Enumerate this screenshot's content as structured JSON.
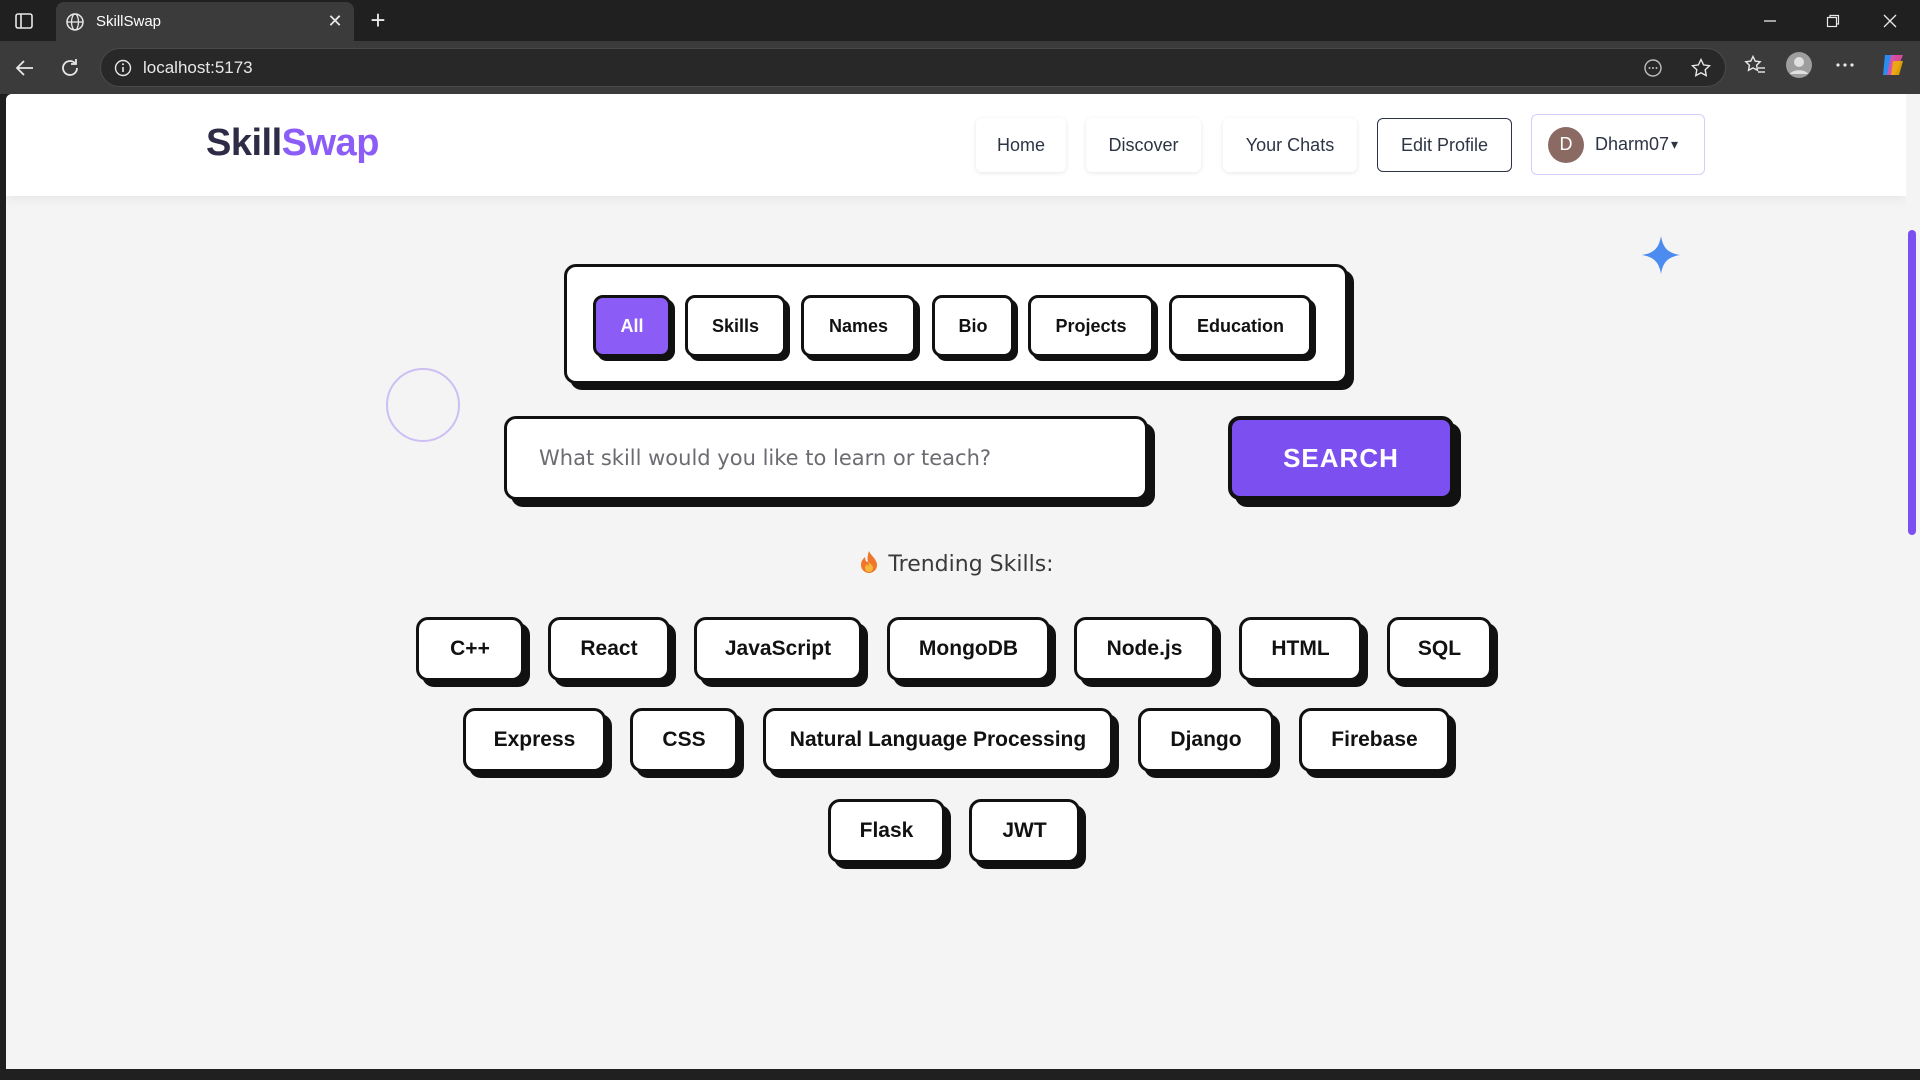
{
  "browser": {
    "tab_title": "SkillSwap",
    "url": "localhost:5173",
    "icons": [
      "sidebar-icon",
      "globe-icon",
      "close-icon",
      "new-tab-icon",
      "back-icon",
      "reload-icon",
      "info-icon",
      "reader-icon",
      "favorite-star-icon",
      "favorites-icon",
      "profile-icon",
      "more-icon",
      "copilot-icon",
      "minimize-icon",
      "restore-icon",
      "window-close-icon"
    ]
  },
  "brand": {
    "part1": "Skill",
    "part2": "Swap",
    "accent": "#8b5cf6"
  },
  "nav": {
    "home": "Home",
    "discover": "Discover",
    "chats": "Your Chats",
    "edit_profile": "Edit Profile",
    "avatar_initial": "D",
    "username": "Dharm07",
    "caret": "▾"
  },
  "filters": {
    "all": "All",
    "skills": "Skills",
    "names": "Names",
    "bio": "Bio",
    "projects": "Projects",
    "education": "Education",
    "active": "All"
  },
  "search": {
    "placeholder": "What skill would you like to learn or teach?",
    "value": "",
    "button": "SEARCH"
  },
  "trending": {
    "label": "Trending Skills:",
    "skills": [
      "C++",
      "React",
      "JavaScript",
      "MongoDB",
      "Node.js",
      "HTML",
      "SQL",
      "Express",
      "CSS",
      "Natural Language Processing",
      "Django",
      "Firebase",
      "Flask",
      "JWT"
    ]
  },
  "colors": {
    "primary": "#7c4ff0",
    "ink": "#111111",
    "background": "#f4f4f5"
  }
}
